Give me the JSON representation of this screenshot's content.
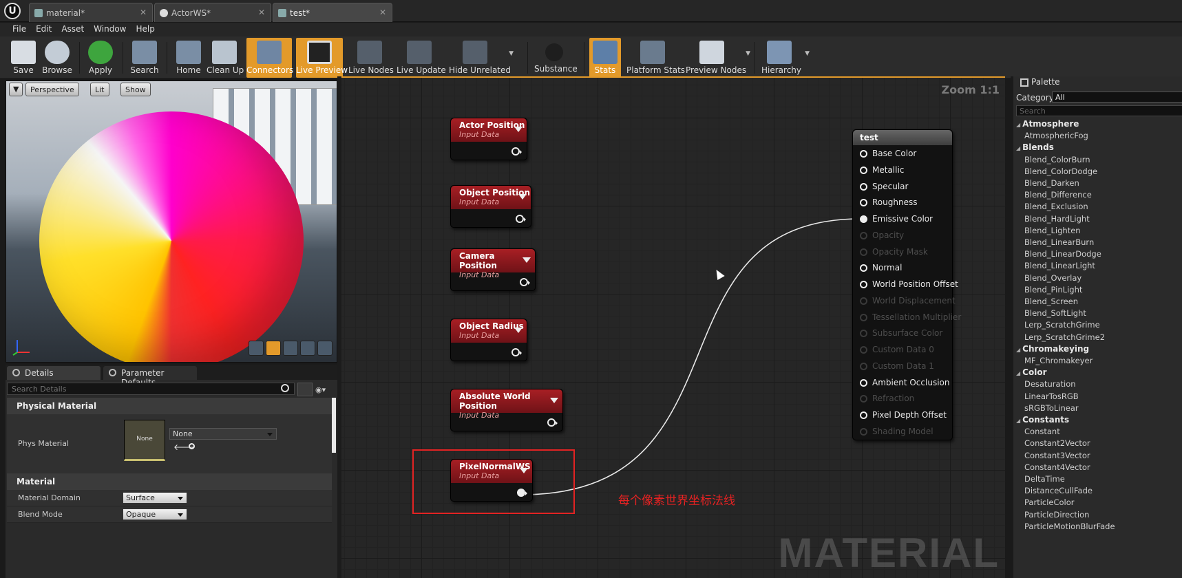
{
  "titlebar": {
    "logo": "U",
    "tabs": [
      {
        "label": "material*",
        "icon": "material-icon"
      },
      {
        "label": "ActorWS*",
        "icon": "actor-icon"
      },
      {
        "label": "test*",
        "icon": "material-icon"
      }
    ]
  },
  "menu": [
    "File",
    "Edit",
    "Asset",
    "Window",
    "Help"
  ],
  "toolbar": [
    {
      "label": "Save",
      "icon": "save-icon",
      "active": false
    },
    {
      "label": "Browse",
      "icon": "browse-icon",
      "active": false
    },
    {
      "label": "Apply",
      "icon": "apply-icon",
      "active": false
    },
    {
      "label": "Search",
      "icon": "binoculars-icon",
      "active": false
    },
    {
      "label": "Home",
      "icon": "home-icon",
      "active": false
    },
    {
      "label": "Clean Up",
      "icon": "broom-icon",
      "active": false
    },
    {
      "label": "Connectors",
      "icon": "connectors-icon",
      "active": true
    },
    {
      "label": "Live Preview",
      "icon": "tv-icon",
      "active": true
    },
    {
      "label": "Live Nodes",
      "icon": "live-nodes-icon",
      "active": false
    },
    {
      "label": "Live Update",
      "icon": "live-update-icon",
      "active": false
    },
    {
      "label": "Hide Unrelated",
      "icon": "hide-unrelated-icon",
      "active": false
    },
    {
      "label": "Substance",
      "icon": "substance-icon",
      "active": false
    },
    {
      "label": "Stats",
      "icon": "stats-icon",
      "active": true
    },
    {
      "label": "Platform Stats",
      "icon": "platform-stats-icon",
      "active": false
    },
    {
      "label": "Preview Nodes",
      "icon": "preview-nodes-icon",
      "active": false
    },
    {
      "label": "Hierarchy",
      "icon": "hierarchy-icon",
      "active": false
    }
  ],
  "viewport": {
    "perspective": "Perspective",
    "lit": "Lit",
    "show": "Show"
  },
  "details": {
    "tab_details": "Details",
    "tab_params": "Parameter Defaults",
    "search_placeholder": "Search Details",
    "section_physical": "Physical Material",
    "phys_material_label": "Phys Material",
    "phys_thumb": "None",
    "phys_value": "None",
    "section_material": "Material",
    "material_domain_label": "Material Domain",
    "material_domain_value": "Surface",
    "blend_mode_label": "Blend Mode",
    "blend_mode_value": "Opaque"
  },
  "graph": {
    "zoom": "Zoom 1:1",
    "watermark": "MATERIAL",
    "annotation": "每个像素世界坐标法线",
    "nodes": [
      {
        "title": "Actor Position",
        "subtitle": "Input Data"
      },
      {
        "title": "Object Position",
        "subtitle": "Input Data"
      },
      {
        "title": "Camera Position",
        "subtitle": "Input Data"
      },
      {
        "title": "Object Radius",
        "subtitle": "Input Data"
      },
      {
        "title": "Absolute World Position",
        "subtitle": "Input Data"
      },
      {
        "title": "PixelNormalWS",
        "subtitle": "Input Data"
      }
    ],
    "result": {
      "title": "test",
      "pins": [
        {
          "label": "Base Color",
          "enabled": true
        },
        {
          "label": "Metallic",
          "enabled": true
        },
        {
          "label": "Specular",
          "enabled": true
        },
        {
          "label": "Roughness",
          "enabled": true
        },
        {
          "label": "Emissive Color",
          "enabled": true,
          "connected": true
        },
        {
          "label": "Opacity",
          "enabled": false
        },
        {
          "label": "Opacity Mask",
          "enabled": false
        },
        {
          "label": "Normal",
          "enabled": true
        },
        {
          "label": "World Position Offset",
          "enabled": true
        },
        {
          "label": "World Displacement",
          "enabled": false
        },
        {
          "label": "Tessellation Multiplier",
          "enabled": false
        },
        {
          "label": "Subsurface Color",
          "enabled": false
        },
        {
          "label": "Custom Data 0",
          "enabled": false
        },
        {
          "label": "Custom Data 1",
          "enabled": false
        },
        {
          "label": "Ambient Occlusion",
          "enabled": true
        },
        {
          "label": "Refraction",
          "enabled": false
        },
        {
          "label": "Pixel Depth Offset",
          "enabled": true
        },
        {
          "label": "Shading Model",
          "enabled": false
        }
      ]
    }
  },
  "palette": {
    "tab": "Palette",
    "category_label": "Category:",
    "category_value": "All",
    "search_placeholder": "Search",
    "entries": [
      {
        "type": "cat",
        "label": "Atmosphere"
      },
      {
        "type": "item",
        "label": "AtmosphericFog"
      },
      {
        "type": "cat",
        "label": "Blends"
      },
      {
        "type": "item",
        "label": "Blend_ColorBurn"
      },
      {
        "type": "item",
        "label": "Blend_ColorDodge"
      },
      {
        "type": "item",
        "label": "Blend_Darken"
      },
      {
        "type": "item",
        "label": "Blend_Difference"
      },
      {
        "type": "item",
        "label": "Blend_Exclusion"
      },
      {
        "type": "item",
        "label": "Blend_HardLight"
      },
      {
        "type": "item",
        "label": "Blend_Lighten"
      },
      {
        "type": "item",
        "label": "Blend_LinearBurn"
      },
      {
        "type": "item",
        "label": "Blend_LinearDodge"
      },
      {
        "type": "item",
        "label": "Blend_LinearLight"
      },
      {
        "type": "item",
        "label": "Blend_Overlay"
      },
      {
        "type": "item",
        "label": "Blend_PinLight"
      },
      {
        "type": "item",
        "label": "Blend_Screen"
      },
      {
        "type": "item",
        "label": "Blend_SoftLight"
      },
      {
        "type": "item",
        "label": "Lerp_ScratchGrime"
      },
      {
        "type": "item",
        "label": "Lerp_ScratchGrime2"
      },
      {
        "type": "cat",
        "label": "Chromakeying"
      },
      {
        "type": "item",
        "label": "MF_Chromakeyer"
      },
      {
        "type": "cat",
        "label": "Color"
      },
      {
        "type": "item",
        "label": "Desaturation"
      },
      {
        "type": "item",
        "label": "LinearTosRGB"
      },
      {
        "type": "item",
        "label": "sRGBToLinear"
      },
      {
        "type": "cat",
        "label": "Constants"
      },
      {
        "type": "item",
        "label": "Constant"
      },
      {
        "type": "item",
        "label": "Constant2Vector"
      },
      {
        "type": "item",
        "label": "Constant3Vector"
      },
      {
        "type": "item",
        "label": "Constant4Vector"
      },
      {
        "type": "item",
        "label": "DeltaTime"
      },
      {
        "type": "item",
        "label": "DistanceCullFade"
      },
      {
        "type": "item",
        "label": "ParticleColor"
      },
      {
        "type": "item",
        "label": "ParticleDirection"
      },
      {
        "type": "item",
        "label": "ParticleMotionBlurFade"
      }
    ]
  },
  "colors": {
    "accent": "#e39a2a",
    "node_header": "#a81f24",
    "highlight": "#e32323"
  }
}
